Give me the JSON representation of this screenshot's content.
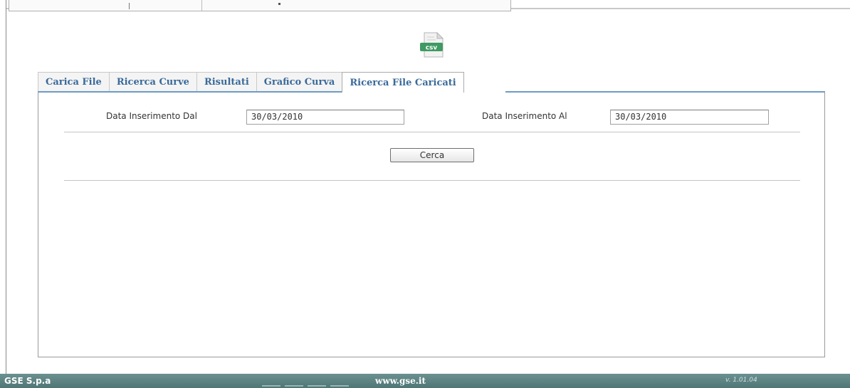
{
  "tabs": [
    {
      "label": "Carica File",
      "active": false
    },
    {
      "label": "Ricerca Curve",
      "active": false
    },
    {
      "label": "Risultati",
      "active": false
    },
    {
      "label": "Grafico Curva",
      "active": false
    },
    {
      "label": "Ricerca File Caricati",
      "active": true
    }
  ],
  "icon": {
    "name": "csv-file-icon",
    "text": "csv"
  },
  "search_form": {
    "date_from_label": "Data Inserimento Dal",
    "date_from_value": "30/03/2010",
    "date_to_label": "Data Inserimento Al",
    "date_to_value": "30/03/2010",
    "search_button": "Cerca"
  },
  "footer": {
    "company": "GSE S.p.a",
    "website": "www.gse.it",
    "version": "v. 1.01.04"
  },
  "colors": {
    "tab_text": "#3a6a9a",
    "tab_underline": "#6e9bc3",
    "footer_bg": "#5a8282"
  }
}
